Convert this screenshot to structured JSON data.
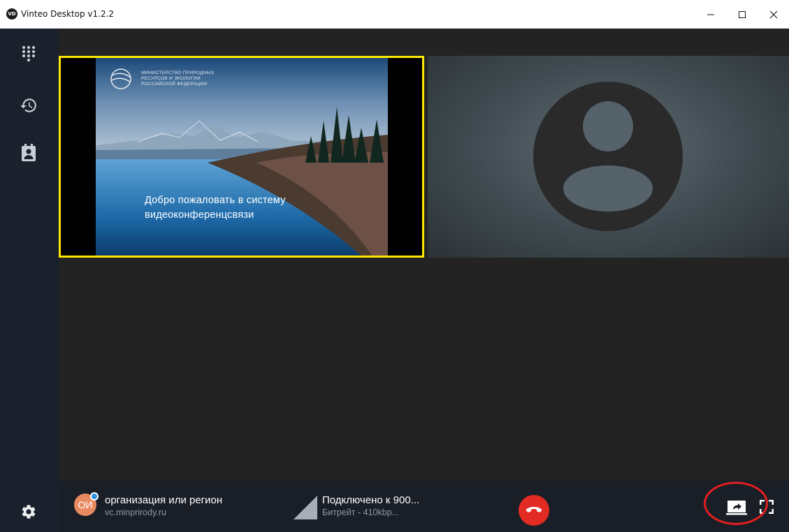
{
  "window": {
    "title": "Vinteo Desktop v1.2.2",
    "logo_text": "VD",
    "controls": [
      "minimize",
      "maximize",
      "close"
    ]
  },
  "sidebar": {
    "items": [
      {
        "icon": "dialpad-icon"
      },
      {
        "icon": "history-icon"
      },
      {
        "icon": "contacts-icon"
      },
      {
        "icon": "gear-icon"
      }
    ]
  },
  "presentation": {
    "ministry_lines": [
      "МИНИСТЕРСТВО ПРИРОДНЫХ",
      "РЕСУРСОВ И ЭКОЛОГИИ",
      "РОССИЙСКОЙ ФЕДЕРАЦИИ"
    ],
    "welcome_line1": "Добро пожаловать в систему",
    "welcome_line2": "видеоконференцсвязи",
    "highlight_color": "#ffe600"
  },
  "call": {
    "avatar_initials": "ОИ",
    "participant_name": "организация или регион",
    "participant_host": "vc.minprirody.ru",
    "status": "Подключено к 900...",
    "bitrate": "Битрейт - 410kbp..."
  },
  "colors": {
    "hangup": "#e22b22",
    "annotation_circle": "#e32020"
  }
}
